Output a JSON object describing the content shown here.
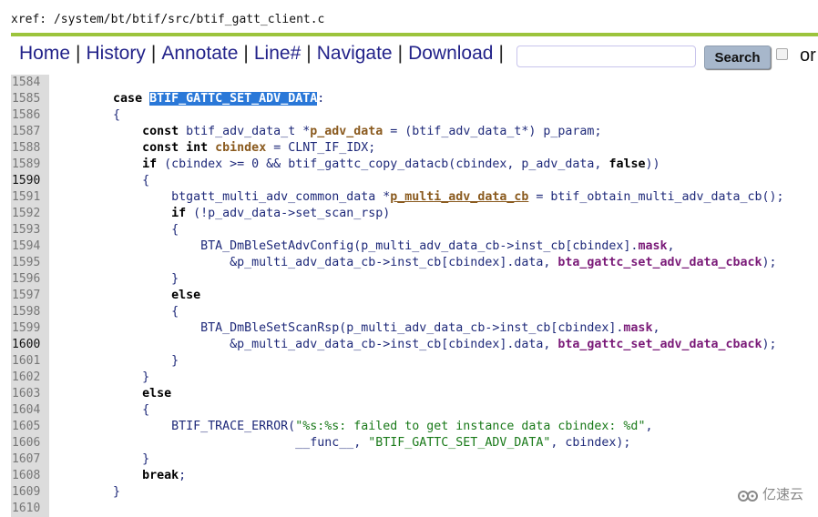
{
  "header": {
    "xref": "xref: /system/bt/btif/src/btif_gatt_client.c"
  },
  "nav": {
    "items": [
      "Home",
      "History",
      "Annotate",
      "Line#",
      "Navigate",
      "Download"
    ],
    "search_label": "Search",
    "search_value": "",
    "or_label": "or"
  },
  "colors": {
    "accent_rule": "#9cc43c",
    "nav_link": "#23238a",
    "selection": "#2a78d8"
  },
  "code": {
    "lines": [
      {
        "n": "1584",
        "t": []
      },
      {
        "n": "1585",
        "t": [
          [
            "",
            "        "
          ],
          [
            "k",
            "case"
          ],
          [
            "",
            " "
          ],
          [
            "hl",
            "BTIF_GATTC_SET_ADV_DATA"
          ],
          [
            "",
            ":"
          ]
        ]
      },
      {
        "n": "1586",
        "t": [
          [
            "",
            "        {"
          ]
        ]
      },
      {
        "n": "1587",
        "t": [
          [
            "",
            "            "
          ],
          [
            "k",
            "const"
          ],
          [
            "",
            " btif_adv_data_t *"
          ],
          [
            "l",
            "p_adv_data"
          ],
          [
            "",
            " = (btif_adv_data_t*) p_param;"
          ]
        ]
      },
      {
        "n": "1588",
        "t": [
          [
            "",
            "            "
          ],
          [
            "k",
            "const int"
          ],
          [
            "",
            " "
          ],
          [
            "l",
            "cbindex"
          ],
          [
            "",
            " = CLNT_IF_IDX;"
          ]
        ]
      },
      {
        "n": "1589",
        "t": [
          [
            "",
            "            "
          ],
          [
            "k",
            "if"
          ],
          [
            "",
            " (cbindex >= 0 && btif_gattc_copy_datacb(cbindex, p_adv_data, "
          ],
          [
            "k",
            "false"
          ],
          [
            "",
            "))"
          ]
        ]
      },
      {
        "n": "1590",
        "dark": true,
        "t": [
          [
            "",
            "            {"
          ]
        ]
      },
      {
        "n": "1591",
        "t": [
          [
            "",
            "                btgatt_multi_adv_common_data *"
          ],
          [
            "lu",
            "p_multi_adv_data_cb"
          ],
          [
            "",
            " = btif_obtain_multi_adv_data_cb();"
          ]
        ]
      },
      {
        "n": "1592",
        "t": [
          [
            "",
            "                "
          ],
          [
            "k",
            "if"
          ],
          [
            "",
            " (!p_adv_data->set_scan_rsp)"
          ]
        ]
      },
      {
        "n": "1593",
        "t": [
          [
            "",
            "                {"
          ]
        ]
      },
      {
        "n": "1594",
        "t": [
          [
            "",
            "                    BTA_DmBleSetAdvConfig(p_multi_adv_data_cb->inst_cb[cbindex]."
          ],
          [
            "f",
            "mask"
          ],
          [
            "",
            ","
          ]
        ]
      },
      {
        "n": "1595",
        "t": [
          [
            "",
            "                        &p_multi_adv_data_cb->inst_cb[cbindex].data, "
          ],
          [
            "f",
            "bta_gattc_set_adv_data_cback"
          ],
          [
            "",
            ");"
          ]
        ]
      },
      {
        "n": "1596",
        "t": [
          [
            "",
            "                }"
          ]
        ]
      },
      {
        "n": "1597",
        "t": [
          [
            "",
            "                "
          ],
          [
            "k",
            "else"
          ]
        ]
      },
      {
        "n": "1598",
        "t": [
          [
            "",
            "                {"
          ]
        ]
      },
      {
        "n": "1599",
        "t": [
          [
            "",
            "                    BTA_DmBleSetScanRsp(p_multi_adv_data_cb->inst_cb[cbindex]."
          ],
          [
            "f",
            "mask"
          ],
          [
            "",
            ","
          ]
        ]
      },
      {
        "n": "1600",
        "dark": true,
        "t": [
          [
            "",
            "                        &p_multi_adv_data_cb->inst_cb[cbindex].data, "
          ],
          [
            "f",
            "bta_gattc_set_adv_data_cback"
          ],
          [
            "",
            ");"
          ]
        ]
      },
      {
        "n": "1601",
        "t": [
          [
            "",
            "                }"
          ]
        ]
      },
      {
        "n": "1602",
        "t": [
          [
            "",
            "            }"
          ]
        ]
      },
      {
        "n": "1603",
        "t": [
          [
            "",
            "            "
          ],
          [
            "k",
            "else"
          ]
        ]
      },
      {
        "n": "1604",
        "t": [
          [
            "",
            "            {"
          ]
        ]
      },
      {
        "n": "1605",
        "t": [
          [
            "",
            "                BTIF_TRACE_ERROR("
          ],
          [
            "s",
            "\"%s:%s: failed to get instance data cbindex: %d\""
          ],
          [
            "",
            ","
          ]
        ]
      },
      {
        "n": "1606",
        "t": [
          [
            "",
            "                                 __func__, "
          ],
          [
            "s",
            "\"BTIF_GATTC_SET_ADV_DATA\""
          ],
          [
            "",
            ", cbindex);"
          ]
        ]
      },
      {
        "n": "1607",
        "t": [
          [
            "",
            "            }"
          ]
        ]
      },
      {
        "n": "1608",
        "t": [
          [
            "",
            "            "
          ],
          [
            "k",
            "break"
          ],
          [
            "",
            ";"
          ]
        ]
      },
      {
        "n": "1609",
        "t": [
          [
            "",
            "        }"
          ]
        ]
      },
      {
        "n": "1610",
        "t": []
      }
    ]
  },
  "watermark": {
    "text": "亿速云",
    "icon": "cloud-logo-icon"
  }
}
